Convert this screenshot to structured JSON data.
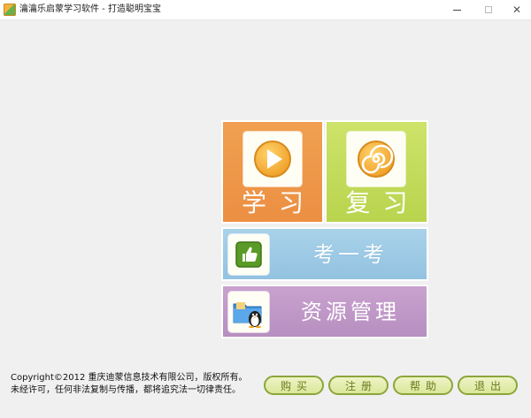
{
  "window": {
    "title": "瀹瀹乐启蒙学习软件 - 打造聪明宝宝",
    "minimize_glyph": "",
    "maximize_glyph": "",
    "close_glyph": "✕"
  },
  "tiles": {
    "learn": {
      "label": "学习",
      "icon": "play-icon",
      "color": "#ec8f43"
    },
    "review": {
      "label": "复习",
      "icon": "spiral-icon",
      "color": "#b9d44e"
    },
    "test": {
      "label": "考一考",
      "icon": "thumbs-up-icon",
      "color": "#93c2e0"
    },
    "resource": {
      "label": "资源管理",
      "icon": "folder-penguin-icon",
      "color": "#b78fc0"
    }
  },
  "footer": {
    "copyright_line1": "Copyright©2012 重庆迪蒙信息技术有限公司，版权所有。",
    "copyright_line2": "未经许可，任何非法复制与传播，都将追究法一切律责任。"
  },
  "buttons": {
    "buy": "购买",
    "register": "注册",
    "help": "帮助",
    "exit": "退出"
  }
}
